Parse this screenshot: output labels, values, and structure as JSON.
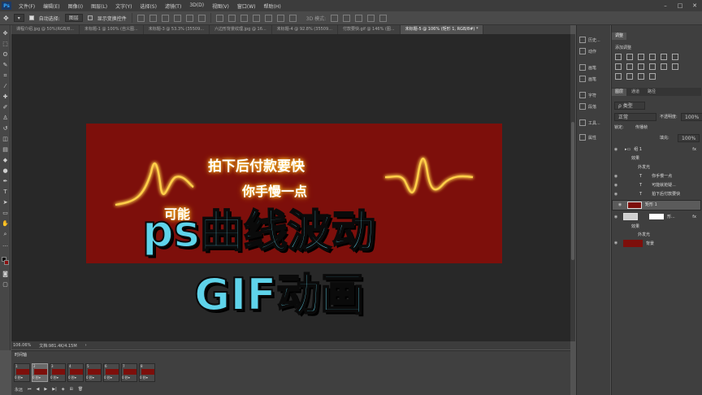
{
  "menu": [
    "文件(F)",
    "编辑(E)",
    "图像(I)",
    "图层(L)",
    "文字(Y)",
    "选择(S)",
    "滤镜(T)",
    "3D(D)",
    "视图(V)",
    "窗口(W)",
    "帮助(H)"
  ],
  "logo": "Ps",
  "options": {
    "auto_select_label": "自动选择:",
    "auto_select_value": "图层",
    "show_transform_label": "显示变换控件",
    "mode_3d_label": "3D 模式:"
  },
  "tabs": [
    "课程介绍.jpg @ 50%(RGB/8...",
    "未标题-1 @ 100% (自义图...",
    "未标题-3 @ 53.3% (35509...",
    "六边形背景纹理.jpg @ 16...",
    "未标题-4 @ 92.8% (35509...",
    "付款要快.gif @ 146% (图...",
    "未标题-5 @ 106% (矩形 1, RGB/8#) *"
  ],
  "document": {
    "line1": "拍下后付款要快",
    "line2": "你手慢一点",
    "line3": "可能"
  },
  "overlay": {
    "line1": "ps曲线波动",
    "line2": "GIF动画"
  },
  "status": {
    "zoom": "106.06%",
    "doc": "文档:981.4K/4.15M"
  },
  "timeline": {
    "title": "时间轴",
    "frames": [
      {
        "num": "1",
        "delay": "0 秒▾"
      },
      {
        "num": "2",
        "delay": "0 秒▾"
      },
      {
        "num": "3",
        "delay": "0 秒▾"
      },
      {
        "num": "4",
        "delay": "0 秒▾"
      },
      {
        "num": "5",
        "delay": "0 秒▾"
      },
      {
        "num": "6",
        "delay": "0 秒▾"
      },
      {
        "num": "7",
        "delay": "0 秒▾"
      },
      {
        "num": "8",
        "delay": "0 秒▾"
      }
    ],
    "loop": "永远"
  },
  "dock": [
    "历史...",
    "动作",
    "画笔",
    "画笔",
    "字符",
    "段落",
    "工具...",
    "属性"
  ],
  "panel": {
    "adj_tabs": [
      "调整"
    ],
    "adj_label": "添加调整",
    "layer_tabs": [
      "图层",
      "通道",
      "路径"
    ],
    "filter_kind": "ρ 类型",
    "blend": "正常",
    "opacity_label": "不透明度:",
    "opacity": "100%",
    "lock_label": "锁定:",
    "fill_label": "填充:",
    "fill": "100%",
    "propagate": "传播帧",
    "layers": [
      {
        "name": "组 1",
        "fx": "fx"
      },
      {
        "name": "效果",
        "fx": ""
      },
      {
        "name": "外发光",
        "fx": ""
      },
      {
        "name": "你手慢一点",
        "fx": ""
      },
      {
        "name": "可能就抢疑...",
        "fx": ""
      },
      {
        "name": "拍下后付款要快",
        "fx": ""
      },
      {
        "name": "矩形 1",
        "fx": ""
      },
      {
        "name": "形...",
        "fx": "fx"
      },
      {
        "name": "效果",
        "fx": ""
      },
      {
        "name": "外发光",
        "fx": ""
      },
      {
        "name": "背景",
        "fx": ""
      }
    ]
  },
  "colors": {
    "doc_red": "#7d0f0b",
    "glow": "#ffb000",
    "overlay_text": "#5fd3ea"
  }
}
